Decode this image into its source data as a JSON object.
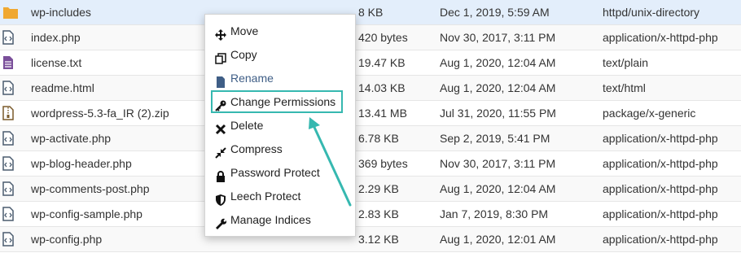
{
  "files": [
    {
      "icon": "folder-icon",
      "name": "wp-includes",
      "size": "8 KB",
      "date": "Dec 1, 2019, 5:59 AM",
      "type": "httpd/unix-directory",
      "selected": true
    },
    {
      "icon": "php-file-icon",
      "name": "index.php",
      "size": "420 bytes",
      "date": "Nov 30, 2017, 3:11 PM",
      "type": "application/x-httpd-php"
    },
    {
      "icon": "text-file-icon",
      "name": "license.txt",
      "size": "19.47 KB",
      "date": "Aug 1, 2020, 12:04 AM",
      "type": "text/plain"
    },
    {
      "icon": "html-file-icon",
      "name": "readme.html",
      "size": "14.03 KB",
      "date": "Aug 1, 2020, 12:04 AM",
      "type": "text/html"
    },
    {
      "icon": "zip-file-icon",
      "name": "wordpress-5.3-fa_IR (2).zip",
      "size": "13.41 MB",
      "date": "Jul 31, 2020, 11:55 PM",
      "type": "package/x-generic"
    },
    {
      "icon": "php-file-icon",
      "name": "wp-activate.php",
      "size": "6.78 KB",
      "date": "Sep 2, 2019, 5:41 PM",
      "type": "application/x-httpd-php"
    },
    {
      "icon": "php-file-icon",
      "name": "wp-blog-header.php",
      "size": "369 bytes",
      "date": "Nov 30, 2017, 3:11 PM",
      "type": "application/x-httpd-php"
    },
    {
      "icon": "php-file-icon",
      "name": "wp-comments-post.php",
      "size": "2.29 KB",
      "date": "Aug 1, 2020, 12:04 AM",
      "type": "application/x-httpd-php"
    },
    {
      "icon": "php-file-icon",
      "name": "wp-config-sample.php",
      "size": "2.83 KB",
      "date": "Jan 7, 2019, 8:30 PM",
      "type": "application/x-httpd-php"
    },
    {
      "icon": "php-file-icon",
      "name": "wp-config.php",
      "size": "3.12 KB",
      "date": "Aug 1, 2020, 12:01 AM",
      "type": "application/x-httpd-php"
    }
  ],
  "context_menu": {
    "items": [
      {
        "key": "move",
        "label": "Move",
        "icon": "move-arrows-icon"
      },
      {
        "key": "copy",
        "label": "Copy",
        "icon": "copy-icon"
      },
      {
        "key": "rename",
        "label": "Rename",
        "icon": "file-icon",
        "disabled": true
      },
      {
        "key": "change-permissions",
        "label": "Change Permissions",
        "icon": "key-icon",
        "highlighted": true
      },
      {
        "key": "delete",
        "label": "Delete",
        "icon": "x-icon"
      },
      {
        "key": "compress",
        "label": "Compress",
        "icon": "compress-icon"
      },
      {
        "key": "password-protect",
        "label": "Password Protect",
        "icon": "lock-icon"
      },
      {
        "key": "leech-protect",
        "label": "Leech Protect",
        "icon": "shield-icon"
      },
      {
        "key": "manage-indices",
        "label": "Manage Indices",
        "icon": "wrench-icon"
      }
    ]
  },
  "colors": {
    "highlight_border": "#36b8b0",
    "selected_row": "#e3eefb",
    "folder": "#f0a830",
    "file_icon": "#4a5b6f"
  }
}
